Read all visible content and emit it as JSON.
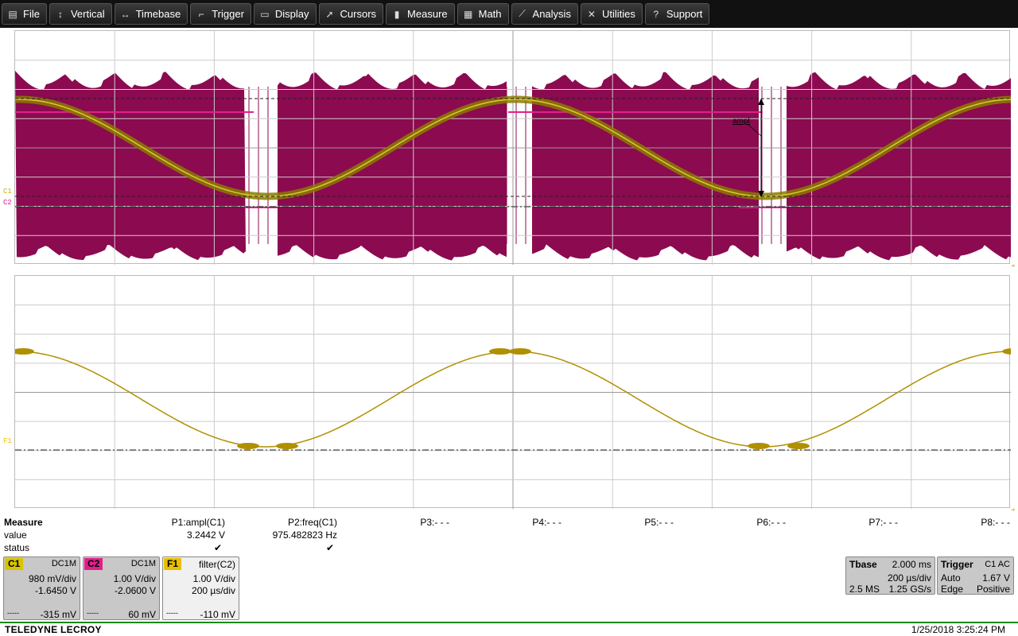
{
  "menu": [
    {
      "label": "File",
      "icon": "file-icon",
      "glyph": "▤"
    },
    {
      "label": "Vertical",
      "icon": "vertical-arrows-icon",
      "glyph": "↕"
    },
    {
      "label": "Timebase",
      "icon": "horizontal-arrows-icon",
      "glyph": "↔"
    },
    {
      "label": "Trigger",
      "icon": "trigger-icon",
      "glyph": "⌐"
    },
    {
      "label": "Display",
      "icon": "display-icon",
      "glyph": "▭"
    },
    {
      "label": "Cursors",
      "icon": "cursor-icon",
      "glyph": "➚"
    },
    {
      "label": "Measure",
      "icon": "measure-icon",
      "glyph": "▮"
    },
    {
      "label": "Math",
      "icon": "calculator-icon",
      "glyph": "▦"
    },
    {
      "label": "Analysis",
      "icon": "analysis-chart-icon",
      "glyph": "⟋"
    },
    {
      "label": "Utilities",
      "icon": "tools-icon",
      "glyph": "✕"
    },
    {
      "label": "Support",
      "icon": "help-icon",
      "glyph": "?"
    }
  ],
  "colors": {
    "c1": "#c8b400",
    "c2": "#e0208a",
    "f1": "#e8c000",
    "c1_trace": "#8a7a00",
    "c2_fill": "#8b0a50",
    "f1_trace": "#b09000",
    "footer_line": "#1a8a1a"
  },
  "grid_labels": {
    "top": {
      "c1": "C1",
      "c2": "C2"
    },
    "bottom": {
      "f1": "F1"
    }
  },
  "cursor_label": "ampl",
  "measure": {
    "header": "Measure",
    "row_labels": [
      "value",
      "status"
    ],
    "params": [
      {
        "name": "P1:ampl(C1)",
        "value": "3.2442 V",
        "status": "✔"
      },
      {
        "name": "P2:freq(C1)",
        "value": "975.482823 Hz",
        "status": "✔"
      },
      {
        "name": "P3:- - -",
        "value": "",
        "status": ""
      },
      {
        "name": "P4:- - -",
        "value": "",
        "status": ""
      },
      {
        "name": "P5:- - -",
        "value": "",
        "status": ""
      },
      {
        "name": "P6:- - -",
        "value": "",
        "status": ""
      },
      {
        "name": "P7:- - -",
        "value": "",
        "status": ""
      },
      {
        "name": "P8:- - -",
        "value": "",
        "status": ""
      }
    ]
  },
  "channels": [
    {
      "tag": "C1",
      "coupling": "DC1M",
      "vdiv": "980 mV/div",
      "offset": "-1.6450 V",
      "bottom_left": "-----",
      "bottom_right": "-315 mV"
    },
    {
      "tag": "C2",
      "coupling": "DC1M",
      "vdiv": "1.00 V/div",
      "offset": "-2.0600 V",
      "bottom_left": "-----",
      "bottom_right": "60 mV"
    },
    {
      "tag": "F1",
      "coupling": "filter(C2)",
      "vdiv": "1.00 V/div",
      "offset": "200 µs/div",
      "bottom_left": "-----",
      "bottom_right": "-110 mV"
    }
  ],
  "timebase": {
    "title": "Tbase",
    "value": "2.000 ms",
    "tdiv": "200 µs/div",
    "samples": "2.5 MS",
    "rate": "1.25 GS/s"
  },
  "trigger": {
    "title": "Trigger",
    "source": "C1 AC",
    "mode": "Auto",
    "level": "1.67 V",
    "type": "Edge",
    "slope": "Positive"
  },
  "footer": {
    "brand": "TELEDYNE LECROY",
    "datetime": "1/25/2018 3:25:24 PM"
  }
}
